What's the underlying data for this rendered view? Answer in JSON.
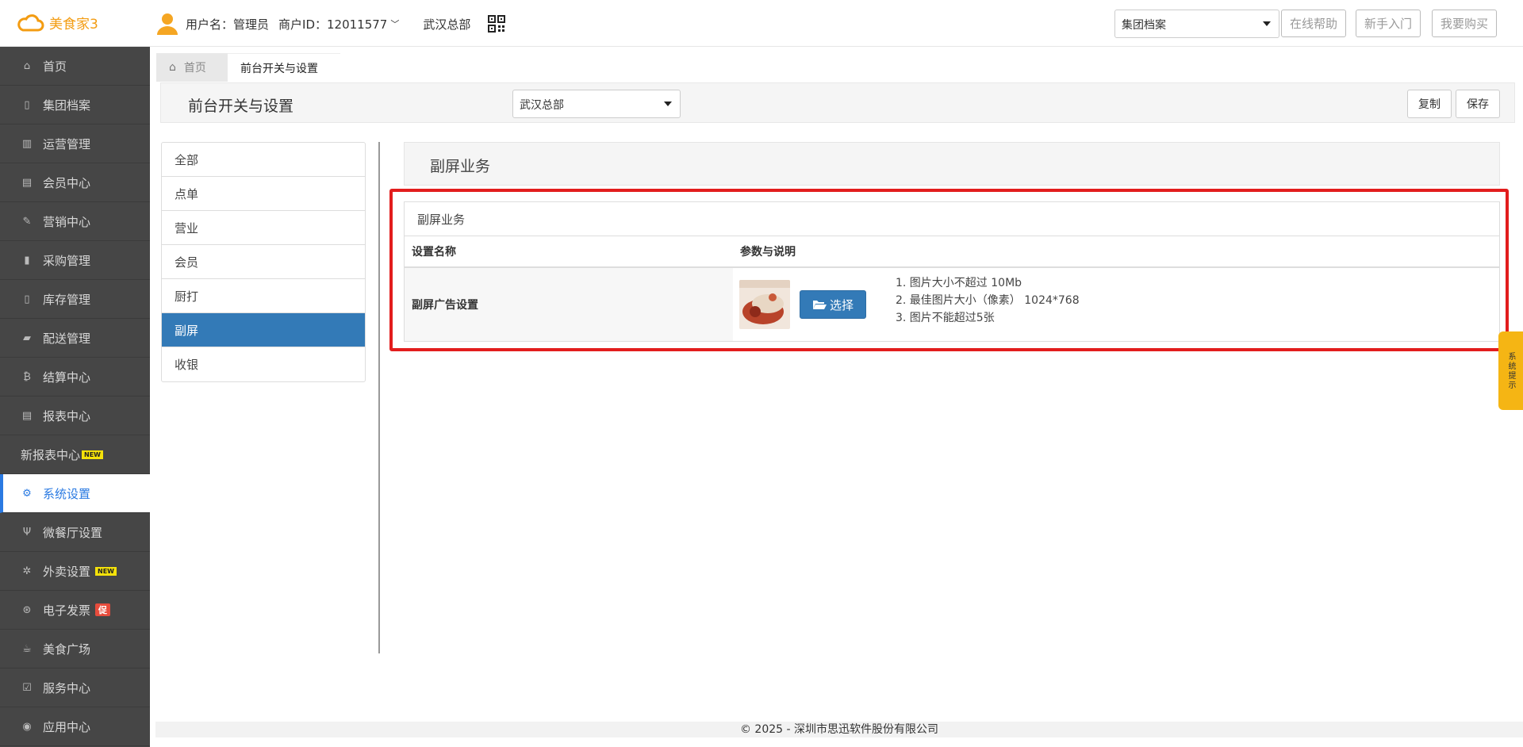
{
  "app": {
    "logo_text": "美食家3",
    "user_label": "用户名：管理员",
    "merchant_label": "商户ID：12011577",
    "store_name": "武汉总部"
  },
  "top": {
    "select_value": "集团档案",
    "help_btn": "在线帮助",
    "guide_btn": "新手入门",
    "buy_btn": "我要购买"
  },
  "sidebar": {
    "items": [
      {
        "label": "首页",
        "icon": "home-icon"
      },
      {
        "label": "集团档案",
        "icon": "file-icon"
      },
      {
        "label": "运营管理",
        "icon": "bar-chart-icon"
      },
      {
        "label": "会员中心",
        "icon": "id-card-icon"
      },
      {
        "label": "营销中心",
        "icon": "edit-icon"
      },
      {
        "label": "采购管理",
        "icon": "book-icon"
      },
      {
        "label": "库存管理",
        "icon": "tablet-icon"
      },
      {
        "label": "配送管理",
        "icon": "truck-icon"
      },
      {
        "label": "结算中心",
        "icon": "bitcoin-icon"
      },
      {
        "label": "报表中心",
        "icon": "report-icon"
      },
      {
        "label": "新报表中心",
        "badge": "NEW"
      },
      {
        "label": "系统设置",
        "icon": "cogs-icon"
      },
      {
        "label": "微餐厅设置",
        "icon": "cutlery-icon"
      },
      {
        "label": "外卖设置",
        "icon": "gear-icon",
        "badge": "NEW"
      },
      {
        "label": "电子发票",
        "icon": "invoice-icon",
        "badge": "促"
      },
      {
        "label": "美食广场",
        "icon": "coffee-icon"
      },
      {
        "label": "服务中心",
        "icon": "check-square-icon"
      },
      {
        "label": "应用中心",
        "icon": "app-icon"
      }
    ]
  },
  "tabs": {
    "home": "首页",
    "current": "前台开关与设置"
  },
  "header": {
    "title": "前台开关与设置",
    "store_select": "武汉总部",
    "copy_btn": "复制",
    "save_btn": "保存"
  },
  "categories": [
    "全部",
    "点单",
    "营业",
    "会员",
    "厨打",
    "副屏",
    "收银"
  ],
  "content": {
    "section_title": "副屏业务",
    "panel_title": "副屏业务",
    "col_name": "设置名称",
    "col_param": "参数与说明",
    "row_name": "副屏广告设置",
    "choose_btn": "选择",
    "notes": [
      "1. 图片大小不超过 10Mb",
      "2. 最佳图片大小（像素） 1024*768",
      "3. 图片不能超过5张"
    ]
  },
  "side_tip": "系统提示",
  "footer": "© 2025 - 深圳市思迅软件股份有限公司",
  "colors": {
    "primary": "#337ab7",
    "highlight": "#e21d1d",
    "accent": "#f39c12"
  }
}
